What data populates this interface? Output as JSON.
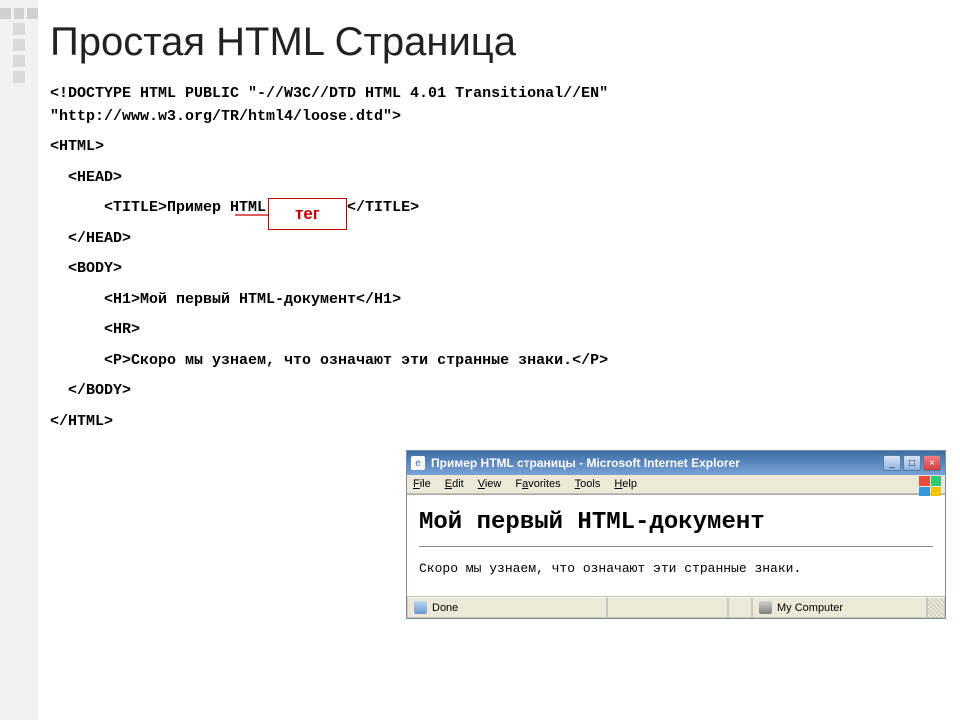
{
  "slide": {
    "title": "Простая HTML Страница",
    "code": {
      "l1": "<!DOCTYPE HTML PUBLIC \"-//W3C//DTD HTML 4.01 Transitional//EN\" \"http://www.w3.org/TR/html4/loose.dtd\">",
      "l2": "<HTML>",
      "l3": "  <HEAD>",
      "l4": "      <TITLE>Пример HTML страницы</TITLE>",
      "l5": "  </HEAD>",
      "l6": "  <BODY>",
      "l7": "      <H1>Мой первый HTML-документ</H1>",
      "l8": "      <HR>",
      "l9": "      <P>Скоро мы узнаем, что означают эти странные знаки.</P>",
      "l10": "  </BODY>",
      "l11": "</HTML>"
    },
    "callout": "тег"
  },
  "ie": {
    "title": "Пример HTML страницы - Microsoft Internet Explorer",
    "menu": {
      "file": "File",
      "edit": "Edit",
      "view": "View",
      "favorites": "Favorites",
      "tools": "Tools",
      "help": "Help"
    },
    "content": {
      "h1": "Мой первый HTML-документ",
      "p": "Скоро мы узнаем, что означают эти странные знаки."
    },
    "status": {
      "done": "Done",
      "computer": "My Computer"
    },
    "winbtn": {
      "min": "_",
      "max": "□",
      "close": "×"
    }
  }
}
